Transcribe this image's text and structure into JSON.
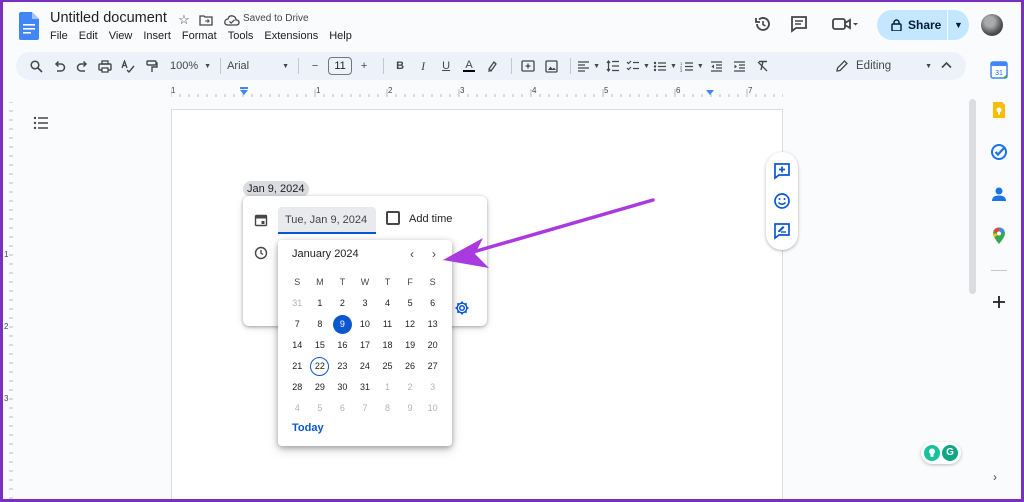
{
  "document": {
    "title": "Untitled document",
    "saved_status": "Saved to Drive"
  },
  "menu": [
    "File",
    "Edit",
    "View",
    "Insert",
    "Format",
    "Tools",
    "Extensions",
    "Help"
  ],
  "share": {
    "label": "Share"
  },
  "toolbar": {
    "zoom": "100%",
    "font": "Arial",
    "font_size": "11",
    "mode": "Editing"
  },
  "ruler": {
    "numbers": [
      "1",
      "1",
      "2",
      "3",
      "4",
      "5",
      "6",
      "7"
    ]
  },
  "vertical_ruler": {
    "numbers": [
      "1",
      "2",
      "3"
    ]
  },
  "date_chip": {
    "label": "Jan 9, 2024"
  },
  "date_card": {
    "date_value": "Tue, Jan 9, 2024",
    "add_time_label": "Add time"
  },
  "calendar": {
    "month_label": "January 2024",
    "weekdays": [
      "S",
      "M",
      "T",
      "W",
      "T",
      "F",
      "S"
    ],
    "weeks": [
      [
        "31",
        "1",
        "2",
        "3",
        "4",
        "5",
        "6"
      ],
      [
        "7",
        "8",
        "9",
        "10",
        "11",
        "12",
        "13"
      ],
      [
        "14",
        "15",
        "16",
        "17",
        "18",
        "19",
        "20"
      ],
      [
        "21",
        "22",
        "23",
        "24",
        "25",
        "26",
        "27"
      ],
      [
        "28",
        "29",
        "30",
        "31",
        "1",
        "2",
        "3"
      ],
      [
        "4",
        "5",
        "6",
        "7",
        "8",
        "9",
        "10"
      ]
    ],
    "selected_day": "9",
    "current_day": "22",
    "today_label": "Today"
  },
  "colors": {
    "accent": "#0b57d0",
    "share_bg": "#c2e7ff",
    "annotation_arrow": "#a93ae0",
    "frame_border": "#7b2fbf"
  },
  "grammarly": {
    "letter": "G"
  }
}
